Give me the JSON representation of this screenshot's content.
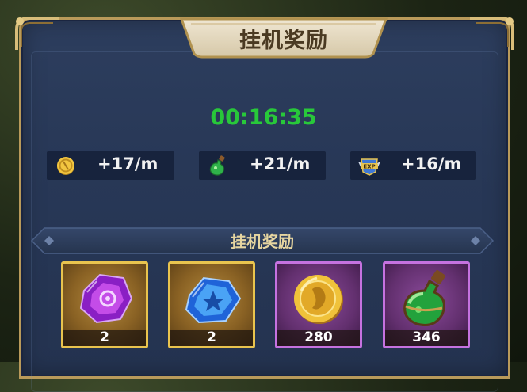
{
  "header": {
    "title": "挂机奖励"
  },
  "timer": {
    "elapsed": "00:16:35"
  },
  "rates": [
    {
      "icon": "gold-coin-icon",
      "text": "+17/m"
    },
    {
      "icon": "green-potion-icon",
      "text": "+21/m"
    },
    {
      "icon": "exp-badge-icon",
      "text": "+16/m"
    }
  ],
  "rewards_section": {
    "title": "挂机奖励"
  },
  "rewards": [
    {
      "icon": "purple-gem-icon",
      "count": "2",
      "frame": "gold"
    },
    {
      "icon": "blue-crystal-icon",
      "count": "2",
      "frame": "gold"
    },
    {
      "icon": "gold-coin-icon",
      "count": "280",
      "frame": "purple"
    },
    {
      "icon": "green-potion-icon",
      "count": "346",
      "frame": "purple"
    }
  ],
  "colors": {
    "timer": "#28c83a",
    "panel": "#283857",
    "frame_gold": "#e9c44e",
    "frame_purple": "#c572e0"
  }
}
